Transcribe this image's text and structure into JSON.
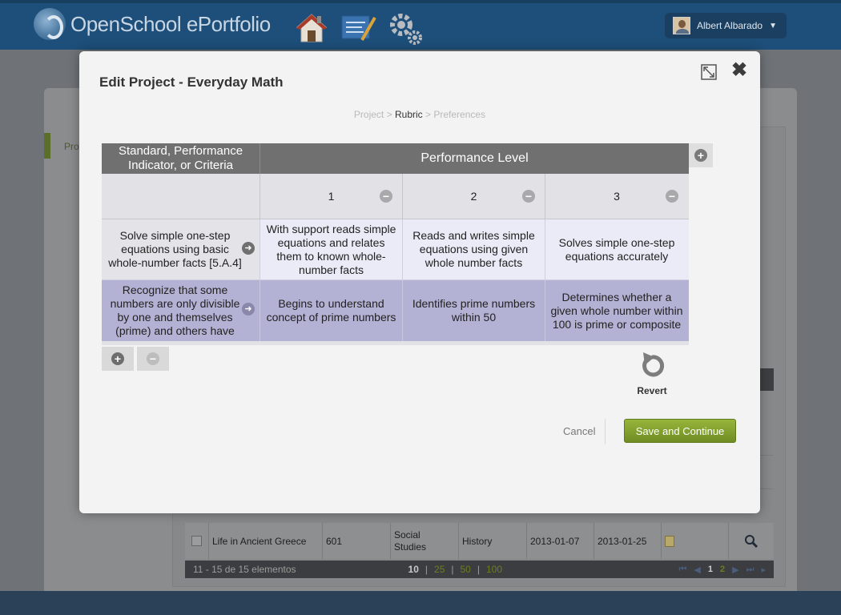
{
  "app": {
    "name": "OpenSchool ePortfolio",
    "user_name": "Albert Albarado"
  },
  "background": {
    "side_label": "Pro",
    "table_row": {
      "title": "Life in Ancient Greece",
      "number": "601",
      "subject": "Social Studies",
      "category": "History",
      "start": "2013-01-07",
      "end": "2013-01-25"
    },
    "footer": {
      "range": "11 - 15 de 15 elementos",
      "page_sizes": [
        "10",
        "25",
        "50",
        "100"
      ],
      "pages": [
        "1",
        "2"
      ]
    }
  },
  "modal": {
    "title": "Edit Project - Everyday Math",
    "breadcrumb": {
      "step1": "Project",
      "sep": ">",
      "step2": "Rubric",
      "step3": "Preferences"
    },
    "rubric": {
      "criteria_header": "Standard, Performance Indicator, or Criteria",
      "level_header": "Performance Level",
      "levels": [
        "1",
        "2",
        "3"
      ],
      "rows": [
        {
          "criteria": "Solve simple one-step equations using basic whole-number facts [5.A.4]",
          "cells": [
            "With support reads simple equations and relates them to known whole-number facts",
            "Reads and writes simple equations using given whole number facts",
            "Solves simple one-step equations accurately"
          ]
        },
        {
          "criteria": "Recognize that some numbers are only divisible by one and themselves (prime) and others have",
          "cells": [
            "Begins to understand concept of prime numbers",
            "Identifies prime numbers within 50",
            "Determines whether a given whole number within 100 is prime or composite"
          ]
        }
      ]
    },
    "revert_label": "Revert",
    "cancel_label": "Cancel",
    "save_label": "Save and Continue"
  }
}
